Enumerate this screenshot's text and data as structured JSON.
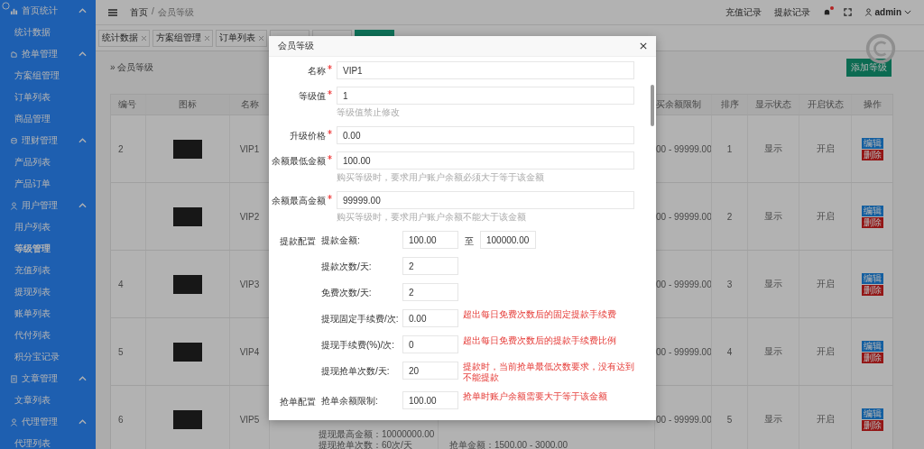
{
  "sidebar": {
    "groups": [
      {
        "label": "首页统计",
        "expanded": true,
        "children": [
          {
            "label": "统计数据",
            "selected": false
          }
        ]
      },
      {
        "label": "抢单管理",
        "expanded": true,
        "children": [
          {
            "label": "方案组管理",
            "selected": false
          },
          {
            "label": "订单列表",
            "selected": false
          },
          {
            "label": "商品管理",
            "selected": false
          }
        ]
      },
      {
        "label": "理财管理",
        "expanded": true,
        "children": [
          {
            "label": "产品列表",
            "selected": false
          },
          {
            "label": "产品订单",
            "selected": false
          }
        ]
      },
      {
        "label": "用户管理",
        "expanded": true,
        "children": [
          {
            "label": "用户列表",
            "selected": false
          },
          {
            "label": "等级管理",
            "selected": true
          },
          {
            "label": "充值列表",
            "selected": false
          },
          {
            "label": "提现列表",
            "selected": false
          },
          {
            "label": "账单列表",
            "selected": false
          },
          {
            "label": "代付列表",
            "selected": false
          },
          {
            "label": "积分宝记录",
            "selected": false
          }
        ]
      },
      {
        "label": "文章管理",
        "expanded": true,
        "children": [
          {
            "label": "文章列表",
            "selected": false
          }
        ]
      },
      {
        "label": "代理管理",
        "expanded": true,
        "children": [
          {
            "label": "代理列表",
            "selected": false
          }
        ]
      }
    ]
  },
  "topbar": {
    "breadcrumb_home": "首页",
    "breadcrumb_separator": "/",
    "breadcrumb_current": "会员等级",
    "links": [
      "充值记录",
      "提款记录"
    ],
    "notification_dot": true,
    "user": "admin"
  },
  "tabs": [
    {
      "label": "统计数据",
      "selected": false
    },
    {
      "label": "方案组管理",
      "selected": false
    },
    {
      "label": "订单列表",
      "selected": false
    },
    {
      "selected": false
    },
    {
      "selected": false
    },
    {
      "selected": true
    }
  ],
  "page": {
    "title": "» 会员等级",
    "add_button": "添加等级"
  },
  "table": {
    "columns": [
      "编号",
      "图标",
      "名称",
      "",
      "",
      "买余额限制",
      "排序",
      "显示状态",
      "开启状态",
      "操作"
    ],
    "rows": [
      {
        "id": "2",
        "name": "VIP1",
        "range": "00 - 99999.00",
        "sort": "1",
        "show": "显示",
        "open": "开启",
        "edit": "编辑",
        "delete": "删除"
      },
      {
        "id": "",
        "name": "VIP2",
        "range": "00 - 99999.00",
        "sort": "2",
        "show": "显示",
        "open": "开启",
        "edit": "编辑",
        "delete": "删除"
      },
      {
        "id": "4",
        "name": "VIP3",
        "range": "00 - 99999.00",
        "sort": "3",
        "show": "显示",
        "open": "开启",
        "edit": "编辑",
        "delete": "删除"
      },
      {
        "id": "5",
        "name": "VIP4",
        "range": "00 - 99999.00",
        "sort": "4",
        "show": "显示",
        "open": "开启",
        "edit": "编辑",
        "delete": "删除"
      },
      {
        "id": "6",
        "name": "VIP5",
        "range": "00 - 99999.00",
        "sort": "5",
        "show": "显示",
        "open": "开启",
        "edit": "编辑",
        "delete": "删除",
        "column_4": [
          "提现最高金额：10000000.00",
          "提现抢单次数：60次/天"
        ],
        "column_5": [
          "抢单金额：1500.00 - 3000.00"
        ]
      }
    ]
  },
  "modal": {
    "title": "会员等级",
    "fields": [
      {
        "label": "名称",
        "required": true,
        "value": "VIP1"
      },
      {
        "label": "等级值",
        "required": true,
        "value": "1",
        "hint": "等级值禁止修改"
      },
      {
        "label": "升级价格",
        "required": true,
        "value": "0.00"
      },
      {
        "label": "余额最低金额",
        "required": true,
        "value": "100.00",
        "hint": "购买等级时，要求用户账户余额必须大于等于该金额"
      },
      {
        "label": "余额最高金额",
        "required": true,
        "value": "99999.00",
        "hint": "购买等级时，要求用户账户余额不能大于该金额"
      }
    ],
    "sections": [
      {
        "label": "提款配置",
        "rows": [
          {
            "label": "提款金额:",
            "value": "100.00",
            "separator": "至",
            "value_2": "100000.00"
          },
          {
            "label": "提款次数/天:",
            "value": "2"
          },
          {
            "label": "免费次数/天:",
            "value": "2"
          },
          {
            "label": "提现固定手续费/次:",
            "value": "0.00",
            "note": "超出每日免费次数后的固定提款手续费"
          },
          {
            "label": "提现手续费(%)/次:",
            "value": "0",
            "note": "超出每日免费次数后的提款手续费比例"
          },
          {
            "label": "提现抢单次数/天:",
            "value": "20",
            "note": "提款时，当前抢单最低次数要求，没有达到不能提款"
          }
        ]
      },
      {
        "label": "抢单配置",
        "rows": [
          {
            "label": "抢单余额限制:",
            "value": "100.00",
            "note": "抢单时账户余额需要大于等于该金额"
          }
        ]
      }
    ]
  }
}
